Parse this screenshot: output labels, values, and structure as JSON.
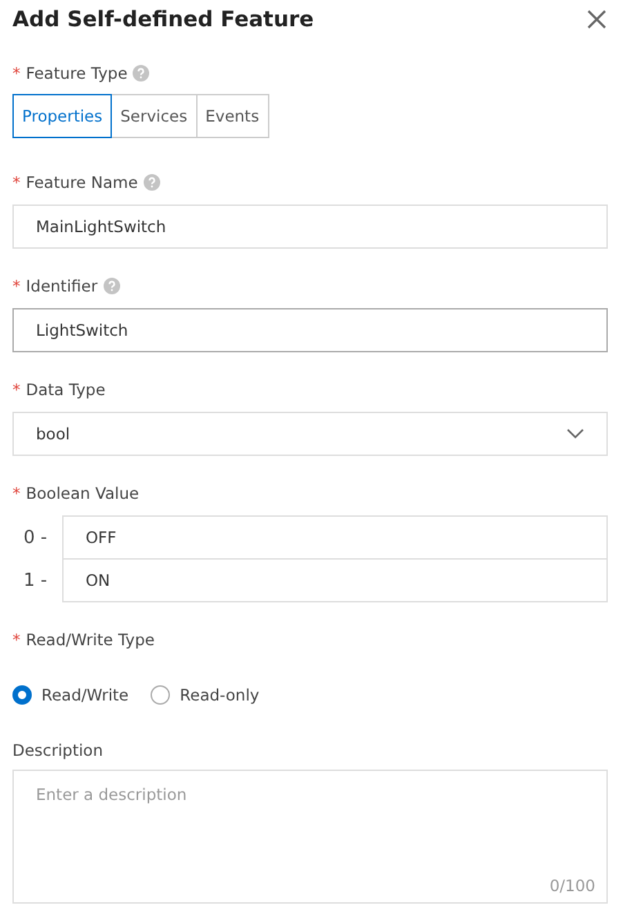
{
  "dialog": {
    "title": "Add Self-defined Feature"
  },
  "feature_type": {
    "mark": "*",
    "label": "Feature Type",
    "help": true,
    "tabs": [
      {
        "label": "Properties",
        "selected": true
      },
      {
        "label": "Services",
        "selected": false
      },
      {
        "label": "Events",
        "selected": false
      }
    ]
  },
  "feature_name": {
    "mark": "*",
    "label": "Feature Name",
    "help": true,
    "value": "MainLightSwitch",
    "hovered": false
  },
  "identifier": {
    "mark": "*",
    "label": "Identifier",
    "help": true,
    "value": "LightSwitch",
    "hovered": true
  },
  "data_type": {
    "mark": "*",
    "label": "Data Type",
    "value": "bool"
  },
  "boolean_value": {
    "mark": "*",
    "label": "Boolean Value",
    "rows": [
      {
        "prefix": "0 -",
        "value": "OFF"
      },
      {
        "prefix": "1 -",
        "value": "ON"
      }
    ]
  },
  "read_write_type": {
    "mark": "*",
    "label": "Read/Write Type",
    "options": [
      {
        "label": "Read/Write",
        "selected": true
      },
      {
        "label": "Read-only",
        "selected": false
      }
    ]
  },
  "description": {
    "label": "Description",
    "placeholder": "Enter a description",
    "counter": "0/100"
  }
}
